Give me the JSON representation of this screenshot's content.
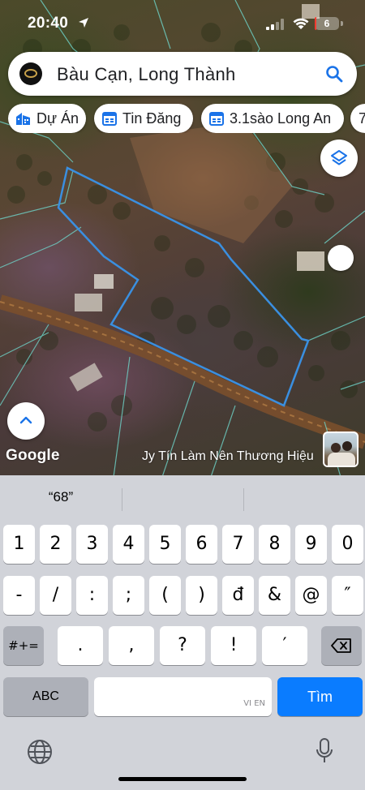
{
  "status_bar": {
    "time": "20:40",
    "battery_level": "6",
    "battery_fraction": 0.06
  },
  "search": {
    "query": "Bàu Cạn, Long Thành",
    "logo": "company-logo",
    "icon": "search-icon"
  },
  "chips": [
    {
      "label": "Dự Án",
      "icon": "project-icon"
    },
    {
      "label": "Tin Đăng",
      "icon": "calendar-icon"
    },
    {
      "label": "3.1sào Long An",
      "icon": "calendar-icon"
    },
    {
      "label": "7",
      "icon": ""
    }
  ],
  "map": {
    "attribution": "Google",
    "caption": "Jy Tín Làm Nên Thương Hiệu",
    "parcel_outline_color": "#3a8fe0",
    "parcel_line_color": "#6ed3c8"
  },
  "keyboard": {
    "suggestion": "“68”",
    "row1": [
      "1",
      "2",
      "3",
      "4",
      "5",
      "6",
      "7",
      "8",
      "9",
      "0"
    ],
    "row2": [
      "-",
      "/",
      ":",
      ";",
      "(",
      ")",
      "đ",
      "&",
      "@",
      "″"
    ],
    "row3_left": "#+=",
    "row3": [
      ".",
      ",",
      "?",
      "!",
      "′"
    ],
    "abc_label": "ABC",
    "space_hint": "VI EN",
    "go_label": "Tìm",
    "accent_color": "#0a7cff"
  }
}
